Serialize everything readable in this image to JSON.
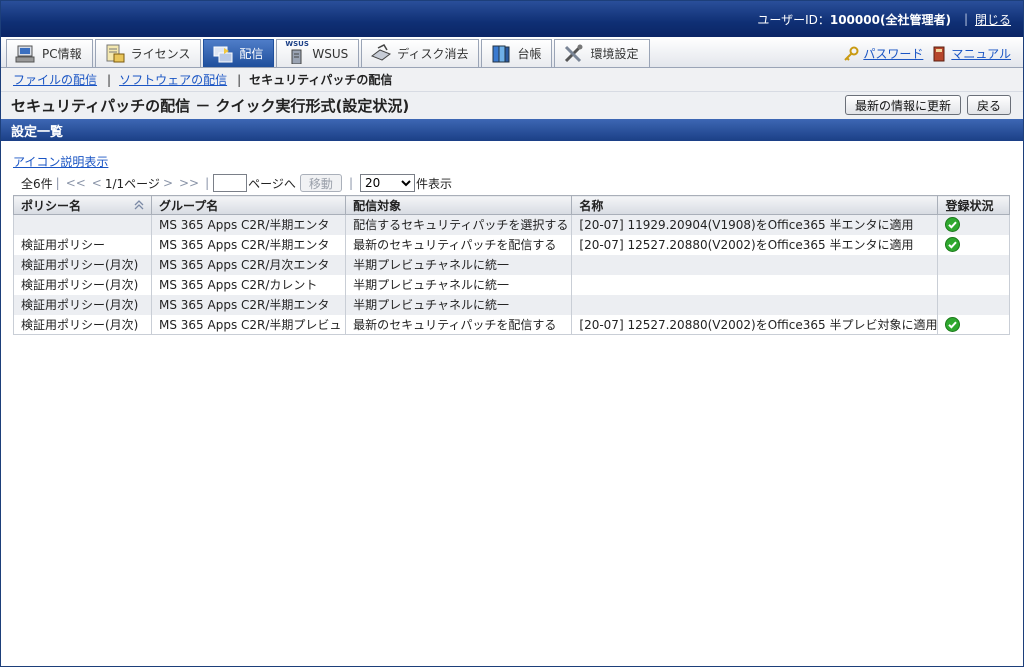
{
  "header": {
    "user_label": "ユーザーID：",
    "user_value": "100000(全社管理者)",
    "close_label": "閉じる"
  },
  "nav": {
    "tabs": [
      {
        "label": "PC情報",
        "icon": "pc-icon"
      },
      {
        "label": "ライセンス",
        "icon": "license-icon"
      },
      {
        "label": "配信",
        "icon": "delivery-icon",
        "active": true
      },
      {
        "label": "WSUS",
        "icon": "wsus-server-icon"
      },
      {
        "label": "ディスク消去",
        "icon": "disk-erase-icon"
      },
      {
        "label": "台帳",
        "icon": "ledger-icon"
      },
      {
        "label": "環境設定",
        "icon": "tools-icon"
      }
    ],
    "wsus_badge": "WSUS",
    "password_label": "パスワード",
    "manual_label": "マニュアル"
  },
  "breadcrumb": {
    "item1": "ファイルの配信",
    "item2": "ソフトウェアの配信",
    "current": "セキュリティパッチの配信",
    "separator": "|"
  },
  "page": {
    "title": "セキュリティパッチの配信 － クイック実行形式(設定状況)",
    "refresh_label": "最新の情報に更新",
    "back_label": "戻る",
    "section_title": "設定一覧",
    "icon_help_link": "アイコン説明表示"
  },
  "pager": {
    "total": "全6件",
    "first": "<<",
    "prev": "<",
    "page_info": "1/1ページ",
    "next": ">",
    "last": ">>",
    "page_input_value": "",
    "goto_suffix": "ページへ",
    "move_label": "移動",
    "per_page_selected": "20",
    "per_page_suffix": "件表示"
  },
  "table": {
    "columns": [
      "ポリシー名",
      "グループ名",
      "配信対象",
      "名称",
      "登録状況"
    ],
    "rows": [
      {
        "policy": "",
        "group": "MS 365 Apps C2R/半期エンタ",
        "target": "配信するセキュリティパッチを選択する",
        "name": "[20-07] 11929.20904(V1908)をOffice365 半エンタに適用",
        "registered": true
      },
      {
        "policy": "検証用ポリシー",
        "group": "MS 365 Apps C2R/半期エンタ",
        "target": "最新のセキュリティパッチを配信する",
        "name": "[20-07] 12527.20880(V2002)をOffice365 半エンタに適用",
        "registered": true
      },
      {
        "policy": "検証用ポリシー(月次)",
        "group": "MS 365 Apps C2R/月次エンタ",
        "target": "半期プレビュチャネルに統一",
        "name": "",
        "registered": false
      },
      {
        "policy": "検証用ポリシー(月次)",
        "group": "MS 365 Apps C2R/カレント",
        "target": "半期プレビュチャネルに統一",
        "name": "",
        "registered": false
      },
      {
        "policy": "検証用ポリシー(月次)",
        "group": "MS 365 Apps C2R/半期エンタ",
        "target": "半期プレビュチャネルに統一",
        "name": "",
        "registered": false
      },
      {
        "policy": "検証用ポリシー(月次)",
        "group": "MS 365 Apps C2R/半期プレビュ",
        "target": "最新のセキュリティパッチを配信する",
        "name": "[20-07] 12527.20880(V2002)をOffice365 半プレビ対象に適用",
        "registered": true
      }
    ],
    "status_icon": "check-icon"
  },
  "colors": {
    "header_blue": "#0f2f74",
    "section_blue": "#1b3f86",
    "link_blue": "#1a55c4",
    "ok_green": "#2fa82f"
  }
}
